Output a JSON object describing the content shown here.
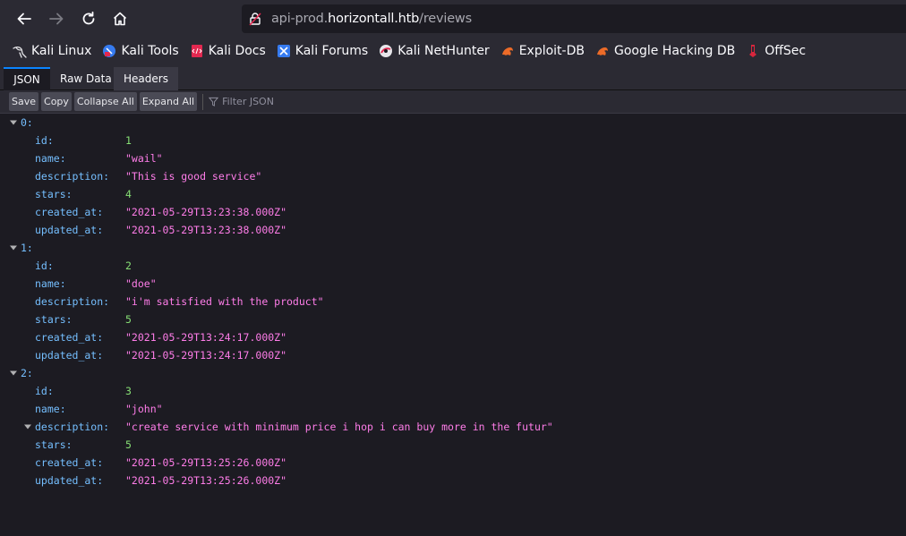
{
  "browser": {
    "url_prefix": "api-prod.",
    "url_host": "horizontall.htb",
    "url_path": "/reviews"
  },
  "bookmarks": [
    {
      "label": "Kali Linux",
      "icon": "kali-dragon-icon"
    },
    {
      "label": "Kali Tools",
      "icon": "kali-tools-icon"
    },
    {
      "label": "Kali Docs",
      "icon": "kali-docs-icon"
    },
    {
      "label": "Kali Forums",
      "icon": "kali-forums-icon"
    },
    {
      "label": "Kali NetHunter",
      "icon": "kali-nethunter-icon"
    },
    {
      "label": "Exploit-DB",
      "icon": "exploit-db-icon"
    },
    {
      "label": "Google Hacking DB",
      "icon": "ghdb-icon"
    },
    {
      "label": "OffSec",
      "icon": "offsec-icon"
    }
  ],
  "viewer_tabs": [
    "JSON",
    "Raw Data",
    "Headers"
  ],
  "toolbar": {
    "save": "Save",
    "copy": "Copy",
    "collapse_all": "Collapse All",
    "expand_all": "Expand All",
    "filter_placeholder": "Filter JSON"
  },
  "records": [
    {
      "index": "0:",
      "id": "1",
      "name": "\"wail\"",
      "description": "\"This is good service\"",
      "stars": "4",
      "created_at": "\"2021-05-29T13:23:38.000Z\"",
      "updated_at": "\"2021-05-29T13:23:38.000Z\""
    },
    {
      "index": "1:",
      "id": "2",
      "name": "\"doe\"",
      "description": "\"i'm satisfied with the product\"",
      "stars": "5",
      "created_at": "\"2021-05-29T13:24:17.000Z\"",
      "updated_at": "\"2021-05-29T13:24:17.000Z\""
    },
    {
      "index": "2:",
      "id": "3",
      "name": "\"john\"",
      "description": "\"create service with minimum price i hop i can buy more in the futur\"",
      "stars": "5",
      "created_at": "\"2021-05-29T13:25:26.000Z\"",
      "updated_at": "\"2021-05-29T13:25:26.000Z\""
    }
  ],
  "keys": {
    "id": "id:",
    "name": "name:",
    "description": "description:",
    "stars": "stars:",
    "created_at": "created_at:",
    "updated_at": "updated_at:"
  },
  "colors": {
    "key": "#75bfff",
    "number": "#86de74",
    "string": "#ff7de9",
    "accent": "#0a84ff"
  }
}
